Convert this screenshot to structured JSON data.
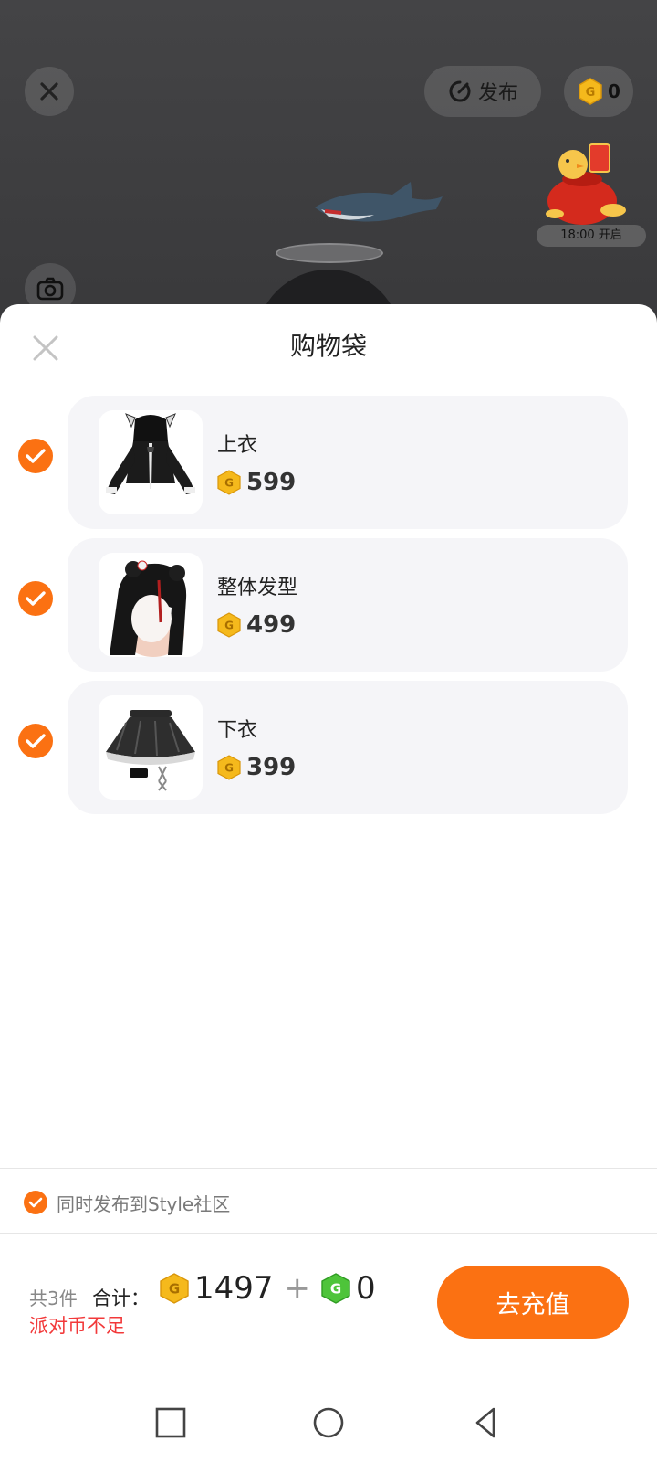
{
  "top_bar": {
    "publish_label": "发布",
    "coin_balance": "0",
    "event_time": "18:00 开启",
    "icons": [
      "close-icon",
      "publish-icon",
      "coin-icon",
      "camera-icon"
    ]
  },
  "sheet": {
    "title": "购物袋",
    "items": [
      {
        "name": "上衣",
        "price": "599",
        "checked": true,
        "thumb_icon": "jacket-thumbnail"
      },
      {
        "name": "整体发型",
        "price": "499",
        "checked": true,
        "thumb_icon": "hairstyle-thumbnail"
      },
      {
        "name": "下衣",
        "price": "399",
        "checked": true,
        "thumb_icon": "skirt-thumbnail"
      }
    ],
    "publish_option": {
      "label": "同时发布到Style社区",
      "checked": true
    }
  },
  "summary": {
    "count_label": "共3件",
    "total_label": "合计：",
    "coin_total": "1497",
    "plus": "+",
    "green_coin_total": "0",
    "warning": "派对币不足",
    "recharge_label": "去充值"
  },
  "colors": {
    "accent": "#fb7112",
    "warning": "#f2393a",
    "coin_gold": "#f5b91c",
    "coin_green": "#4ec43a"
  }
}
